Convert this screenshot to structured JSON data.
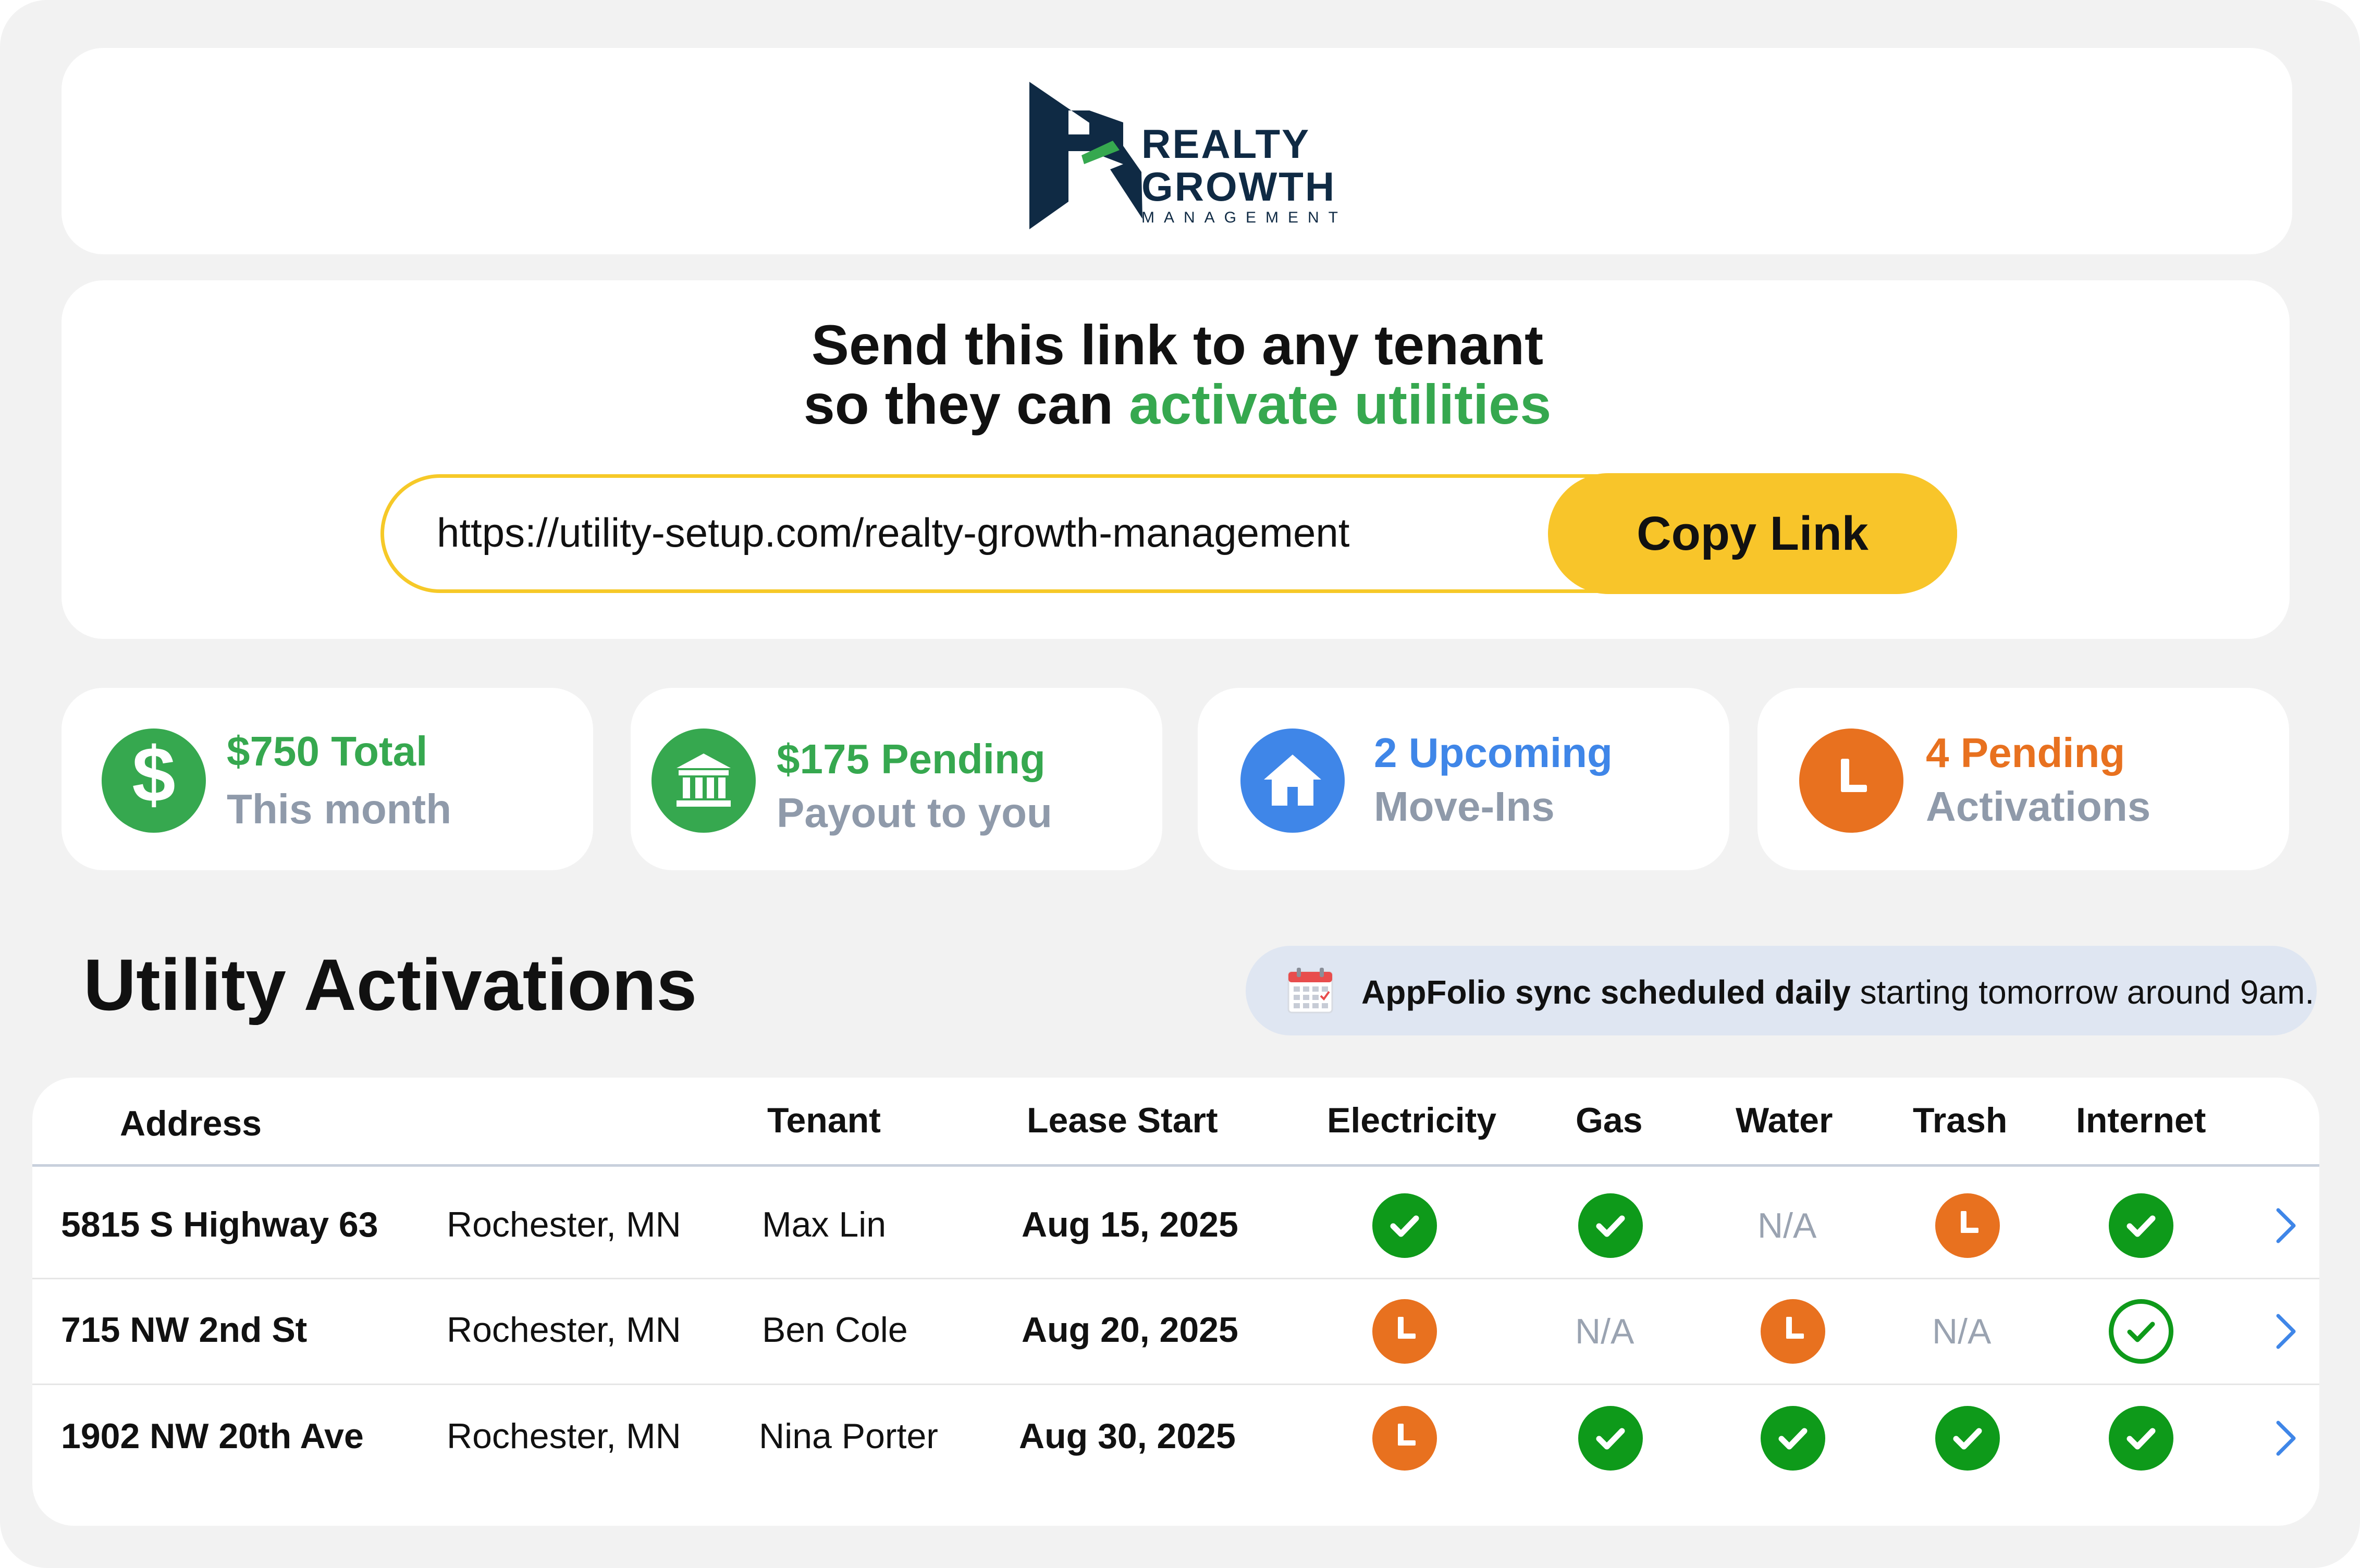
{
  "brand": {
    "line1": "REALTY",
    "line2": "GROWTH",
    "line3": "MANAGEMENT",
    "colors": {
      "navy": "#0f2a44",
      "green": "#36a84f"
    }
  },
  "share": {
    "headline_line1": "Send this link to any tenant",
    "headline_line2_prefix": "so they can ",
    "headline_line2_highlight": "activate utilities",
    "url": "https://utility-setup.com/realty-growth-management",
    "copy_label": "Copy Link",
    "accent": "#f8c52a"
  },
  "stats": [
    {
      "icon": "dollar-icon",
      "line1": "$750 Total",
      "line2": "This month",
      "color": "#36a84f"
    },
    {
      "icon": "bank-icon",
      "line1": "$175 Pending",
      "line2": "Payout to you",
      "color": "#36a84f"
    },
    {
      "icon": "home-icon",
      "line1": "2 Upcoming",
      "line2": "Move-Ins",
      "color": "#3f86e8"
    },
    {
      "icon": "clock-icon",
      "line1": "4 Pending",
      "line2": "Activations",
      "color": "#e8711f"
    }
  ],
  "activations": {
    "title": "Utility Activations",
    "sync_bold": "AppFolio sync scheduled daily",
    "sync_rest": " starting tomorrow around 9am.",
    "columns": [
      "Address",
      "Tenant",
      "Lease Start",
      "Electricity",
      "Gas",
      "Water",
      "Trash",
      "Internet"
    ],
    "rows": [
      {
        "address": "5815 S Highway 63",
        "city": "Rochester, MN",
        "tenant": "Max Lin",
        "lease_start": "Aug 15, 2025",
        "status": [
          "done",
          "done",
          "N/A",
          "pending",
          "done"
        ]
      },
      {
        "address": "715 NW 2nd St",
        "city": "Rochester, MN",
        "tenant": "Ben Cole",
        "lease_start": "Aug 20, 2025",
        "status": [
          "pending",
          "N/A",
          "pending",
          "N/A",
          "outline"
        ]
      },
      {
        "address": "1902 NW 20th Ave",
        "city": "Rochester, MN",
        "tenant": "Nina Porter",
        "lease_start": "Aug 30, 2025",
        "status": [
          "pending",
          "done",
          "done",
          "done",
          "done"
        ]
      }
    ]
  }
}
